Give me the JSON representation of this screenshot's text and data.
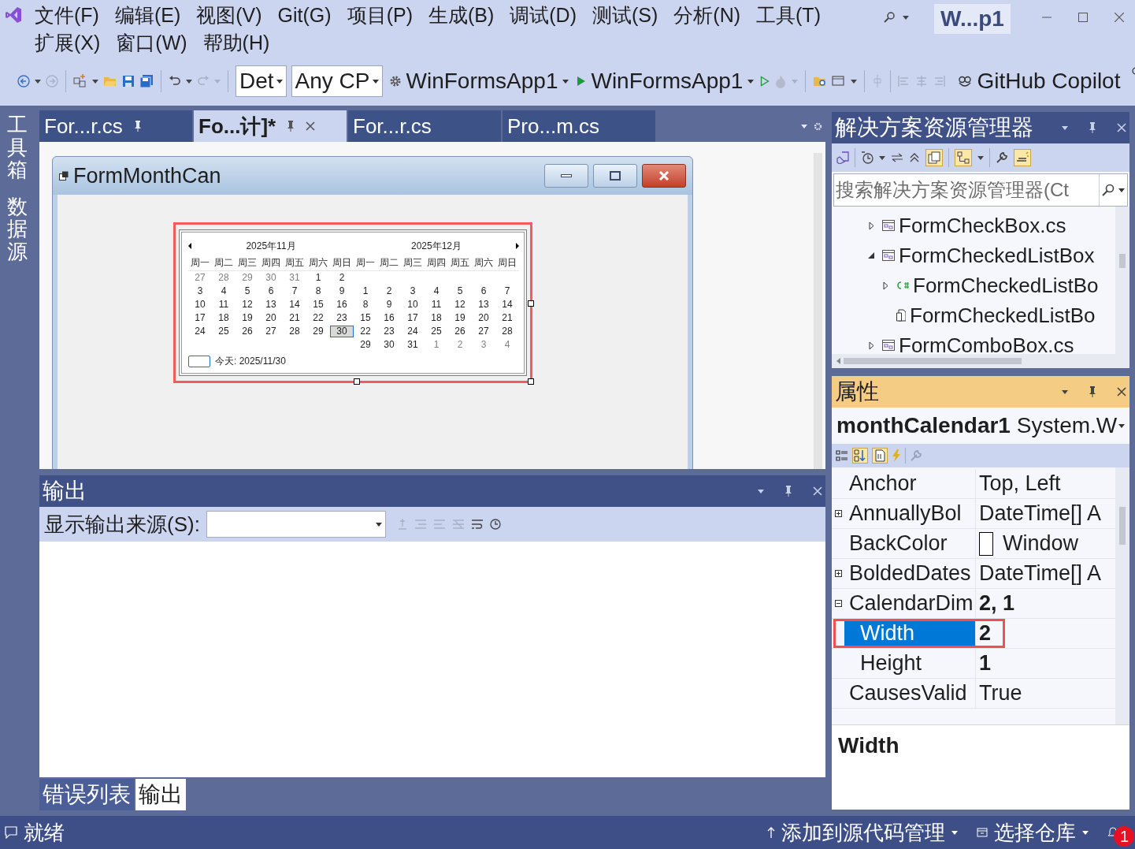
{
  "menu_rows": [
    [
      "文件(F)",
      "编辑(E)",
      "视图(V)",
      "Git(G)",
      "项目(P)",
      "生成(B)",
      "调试(D)",
      "测试(S)",
      "分析(N)",
      "工具(T)"
    ],
    [
      "扩展(X)",
      "窗口(W)",
      "帮助(H)"
    ]
  ],
  "title_badge": "W...p1",
  "toolbar": {
    "configuration": "Det",
    "platform": "Any CP",
    "startup_item": "WinFormsApp1",
    "debug_target": "WinFormsApp1",
    "copilot": "GitHub Copilot"
  },
  "side_tabs": [
    "工具箱",
    "数据源"
  ],
  "document_tabs": [
    {
      "label": "For...r.cs",
      "selected": false,
      "pinned": true
    },
    {
      "label": "Fo...计]*",
      "selected": true,
      "pinned": true
    },
    {
      "label": "For...r.cs",
      "selected": false,
      "pinned": false
    },
    {
      "label": "Pro...m.cs",
      "selected": false,
      "pinned": false
    }
  ],
  "form": {
    "title": "FormMonthCan",
    "calendar": {
      "selected": true,
      "today": "今天: 2025/11/30",
      "months": [
        {
          "title": "2025年11月",
          "weekdays": [
            "周一",
            "周二",
            "周三",
            "周四",
            "周五",
            "周六",
            "周日"
          ],
          "weeks": [
            [
              {
                "text": "27",
                "adjacent": true,
                "selected": false
              },
              {
                "text": "28",
                "adjacent": true,
                "selected": false
              },
              {
                "text": "29",
                "adjacent": true,
                "selected": false
              },
              {
                "text": "30",
                "adjacent": true,
                "selected": false
              },
              {
                "text": "31",
                "adjacent": true,
                "selected": false
              },
              {
                "text": "1",
                "adjacent": false,
                "selected": false
              },
              {
                "text": "2",
                "adjacent": false,
                "selected": false
              }
            ],
            [
              {
                "text": "3",
                "adjacent": false,
                "selected": false
              },
              {
                "text": "4",
                "adjacent": false,
                "selected": false
              },
              {
                "text": "5",
                "adjacent": false,
                "selected": false
              },
              {
                "text": "6",
                "adjacent": false,
                "selected": false
              },
              {
                "text": "7",
                "adjacent": false,
                "selected": false
              },
              {
                "text": "8",
                "adjacent": false,
                "selected": false
              },
              {
                "text": "9",
                "adjacent": false,
                "selected": false
              }
            ],
            [
              {
                "text": "10",
                "adjacent": false,
                "selected": false
              },
              {
                "text": "11",
                "adjacent": false,
                "selected": false
              },
              {
                "text": "12",
                "adjacent": false,
                "selected": false
              },
              {
                "text": "13",
                "adjacent": false,
                "selected": false
              },
              {
                "text": "14",
                "adjacent": false,
                "selected": false
              },
              {
                "text": "15",
                "adjacent": false,
                "selected": false
              },
              {
                "text": "16",
                "adjacent": false,
                "selected": false
              }
            ],
            [
              {
                "text": "17",
                "adjacent": false,
                "selected": false
              },
              {
                "text": "18",
                "adjacent": false,
                "selected": false
              },
              {
                "text": "19",
                "adjacent": false,
                "selected": false
              },
              {
                "text": "20",
                "adjacent": false,
                "selected": false
              },
              {
                "text": "21",
                "adjacent": false,
                "selected": false
              },
              {
                "text": "22",
                "adjacent": false,
                "selected": false
              },
              {
                "text": "23",
                "adjacent": false,
                "selected": false
              }
            ],
            [
              {
                "text": "24",
                "adjacent": false,
                "selected": false
              },
              {
                "text": "25",
                "adjacent": false,
                "selected": false
              },
              {
                "text": "26",
                "adjacent": false,
                "selected": false
              },
              {
                "text": "27",
                "adjacent": false,
                "selected": false
              },
              {
                "text": "28",
                "adjacent": false,
                "selected": false
              },
              {
                "text": "29",
                "adjacent": false,
                "selected": false
              },
              {
                "text": "30",
                "adjacent": false,
                "selected": true
              }
            ]
          ]
        },
        {
          "title": "2025年12月",
          "weekdays": [
            "周一",
            "周二",
            "周三",
            "周四",
            "周五",
            "周六",
            "周日"
          ],
          "weeks": [
            [
              {
                "text": "1",
                "adjacent": false,
                "selected": false
              },
              {
                "text": "2",
                "adjacent": false,
                "selected": false
              },
              {
                "text": "3",
                "adjacent": false,
                "selected": false
              },
              {
                "text": "4",
                "adjacent": false,
                "selected": false
              },
              {
                "text": "5",
                "adjacent": false,
                "selected": false
              },
              {
                "text": "6",
                "adjacent": false,
                "selected": false
              },
              {
                "text": "7",
                "adjacent": false,
                "selected": false
              }
            ],
            [
              {
                "text": "8",
                "adjacent": false,
                "selected": false
              },
              {
                "text": "9",
                "adjacent": false,
                "selected": false
              },
              {
                "text": "10",
                "adjacent": false,
                "selected": false
              },
              {
                "text": "11",
                "adjacent": false,
                "selected": false
              },
              {
                "text": "12",
                "adjacent": false,
                "selected": false
              },
              {
                "text": "13",
                "adjacent": false,
                "selected": false
              },
              {
                "text": "14",
                "adjacent": false,
                "selected": false
              }
            ],
            [
              {
                "text": "15",
                "adjacent": false,
                "selected": false
              },
              {
                "text": "16",
                "adjacent": false,
                "selected": false
              },
              {
                "text": "17",
                "adjacent": false,
                "selected": false
              },
              {
                "text": "18",
                "adjacent": false,
                "selected": false
              },
              {
                "text": "19",
                "adjacent": false,
                "selected": false
              },
              {
                "text": "20",
                "adjacent": false,
                "selected": false
              },
              {
                "text": "21",
                "adjacent": false,
                "selected": false
              }
            ],
            [
              {
                "text": "22",
                "adjacent": false,
                "selected": false
              },
              {
                "text": "23",
                "adjacent": false,
                "selected": false
              },
              {
                "text": "24",
                "adjacent": false,
                "selected": false
              },
              {
                "text": "25",
                "adjacent": false,
                "selected": false
              },
              {
                "text": "26",
                "adjacent": false,
                "selected": false
              },
              {
                "text": "27",
                "adjacent": false,
                "selected": false
              },
              {
                "text": "28",
                "adjacent": false,
                "selected": false
              }
            ],
            [
              {
                "text": "29",
                "adjacent": false,
                "selected": false
              },
              {
                "text": "30",
                "adjacent": false,
                "selected": false
              },
              {
                "text": "31",
                "adjacent": false,
                "selected": false
              },
              {
                "text": "1",
                "adjacent": true,
                "selected": false
              },
              {
                "text": "2",
                "adjacent": true,
                "selected": false
              },
              {
                "text": "3",
                "adjacent": true,
                "selected": false
              },
              {
                "text": "4",
                "adjacent": true,
                "selected": false
              }
            ]
          ]
        }
      ]
    }
  },
  "output": {
    "title": "输出",
    "source_label": "显示输出来源(S):",
    "tabs": [
      {
        "label": "错误列表",
        "selected": false
      },
      {
        "label": "输出",
        "selected": true
      }
    ]
  },
  "solution_explorer": {
    "title": "解决方案资源管理器",
    "search": {
      "placeholder": "搜索解决方案资源管理器(Ct"
    },
    "tree": [
      {
        "label": "FormCheckBox.cs",
        "kind": "form",
        "expanded": false
      },
      {
        "label": "FormCheckedListBox",
        "kind": "form",
        "expanded": true,
        "children": [
          {
            "label": "FormCheckedListBo",
            "kind": "csharp",
            "expanded": false
          },
          {
            "label": "FormCheckedListBo",
            "kind": "resource"
          }
        ]
      },
      {
        "label": "FormComboBox.cs",
        "kind": "form",
        "expanded": false
      }
    ]
  },
  "properties": {
    "title": "属性",
    "object": "**monthCalendar1** System.W",
    "rows": [
      {
        "name": "Anchor",
        "value": "Top, Left",
        "kind": "text",
        "modified": false,
        "selected": false
      },
      {
        "name": "AnnuallyBol",
        "value": "DateTime[] A",
        "kind": "text",
        "expanded": false,
        "modified": false,
        "selected": false
      },
      {
        "name": "BackColor",
        "value": "Window",
        "kind": "color",
        "color": "#ffffff",
        "modified": false,
        "selected": false
      },
      {
        "name": "BoldedDates",
        "value": "DateTime[] A",
        "kind": "text",
        "expanded": false,
        "modified": false,
        "selected": false
      },
      {
        "name": "CalendarDim",
        "value": "2, 1",
        "kind": "text",
        "expanded": true,
        "modified": true,
        "selected": false,
        "children": [
          {
            "name": "Width",
            "value": "2",
            "kind": "text",
            "modified": true,
            "selected": true
          },
          {
            "name": "Height",
            "value": "1",
            "kind": "text",
            "modified": true,
            "selected": false
          }
        ]
      },
      {
        "name": "CausesValid",
        "value": "True",
        "kind": "text",
        "modified": false,
        "selected": false
      }
    ],
    "description": "Width"
  },
  "status_bar": {
    "message": "就绪",
    "source_control": "添加到源代码管理",
    "repository": "选择仓库",
    "notifications": "1"
  }
}
